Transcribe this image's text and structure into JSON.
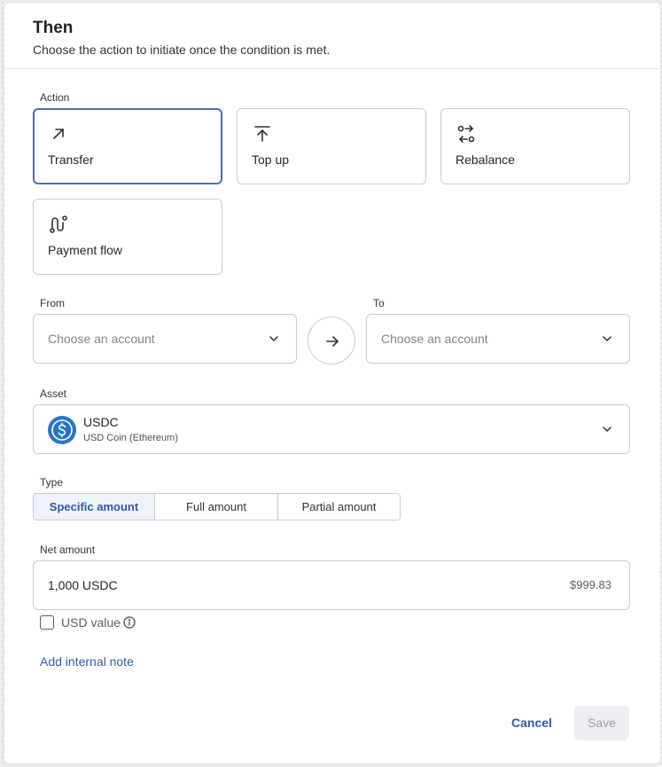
{
  "header": {
    "title": "Then",
    "subtitle": "Choose the action to initiate once the condition is met."
  },
  "action": {
    "label": "Action",
    "options": [
      {
        "label": "Transfer",
        "icon": "arrow-up-right-icon",
        "selected": true
      },
      {
        "label": "Top up",
        "icon": "arrow-up-to-line-icon",
        "selected": false
      },
      {
        "label": "Rebalance",
        "icon": "rebalance-icon",
        "selected": false
      },
      {
        "label": "Payment flow",
        "icon": "payment-flow-icon",
        "selected": false
      }
    ]
  },
  "from": {
    "label": "From",
    "placeholder": "Choose an account"
  },
  "to": {
    "label": "To",
    "placeholder": "Choose an account"
  },
  "asset": {
    "label": "Asset",
    "name": "USDC",
    "subtitle": "USD Coin (Ethereum)",
    "logo_color": "#2775ca"
  },
  "type": {
    "label": "Type",
    "options": [
      "Specific amount",
      "Full amount",
      "Partial amount"
    ],
    "selected": "Specific amount"
  },
  "net_amount": {
    "label": "Net amount",
    "value": "1,000 USDC",
    "usd_value": "$999.83"
  },
  "usd_checkbox": {
    "label": "USD value",
    "checked": false
  },
  "internal_note_link": "Add internal note",
  "footer": {
    "cancel": "Cancel",
    "save": "Save"
  },
  "colors": {
    "accent": "#2f5aa6",
    "selected_border": "#4a6fb0",
    "selected_bg": "#eef3fb"
  }
}
